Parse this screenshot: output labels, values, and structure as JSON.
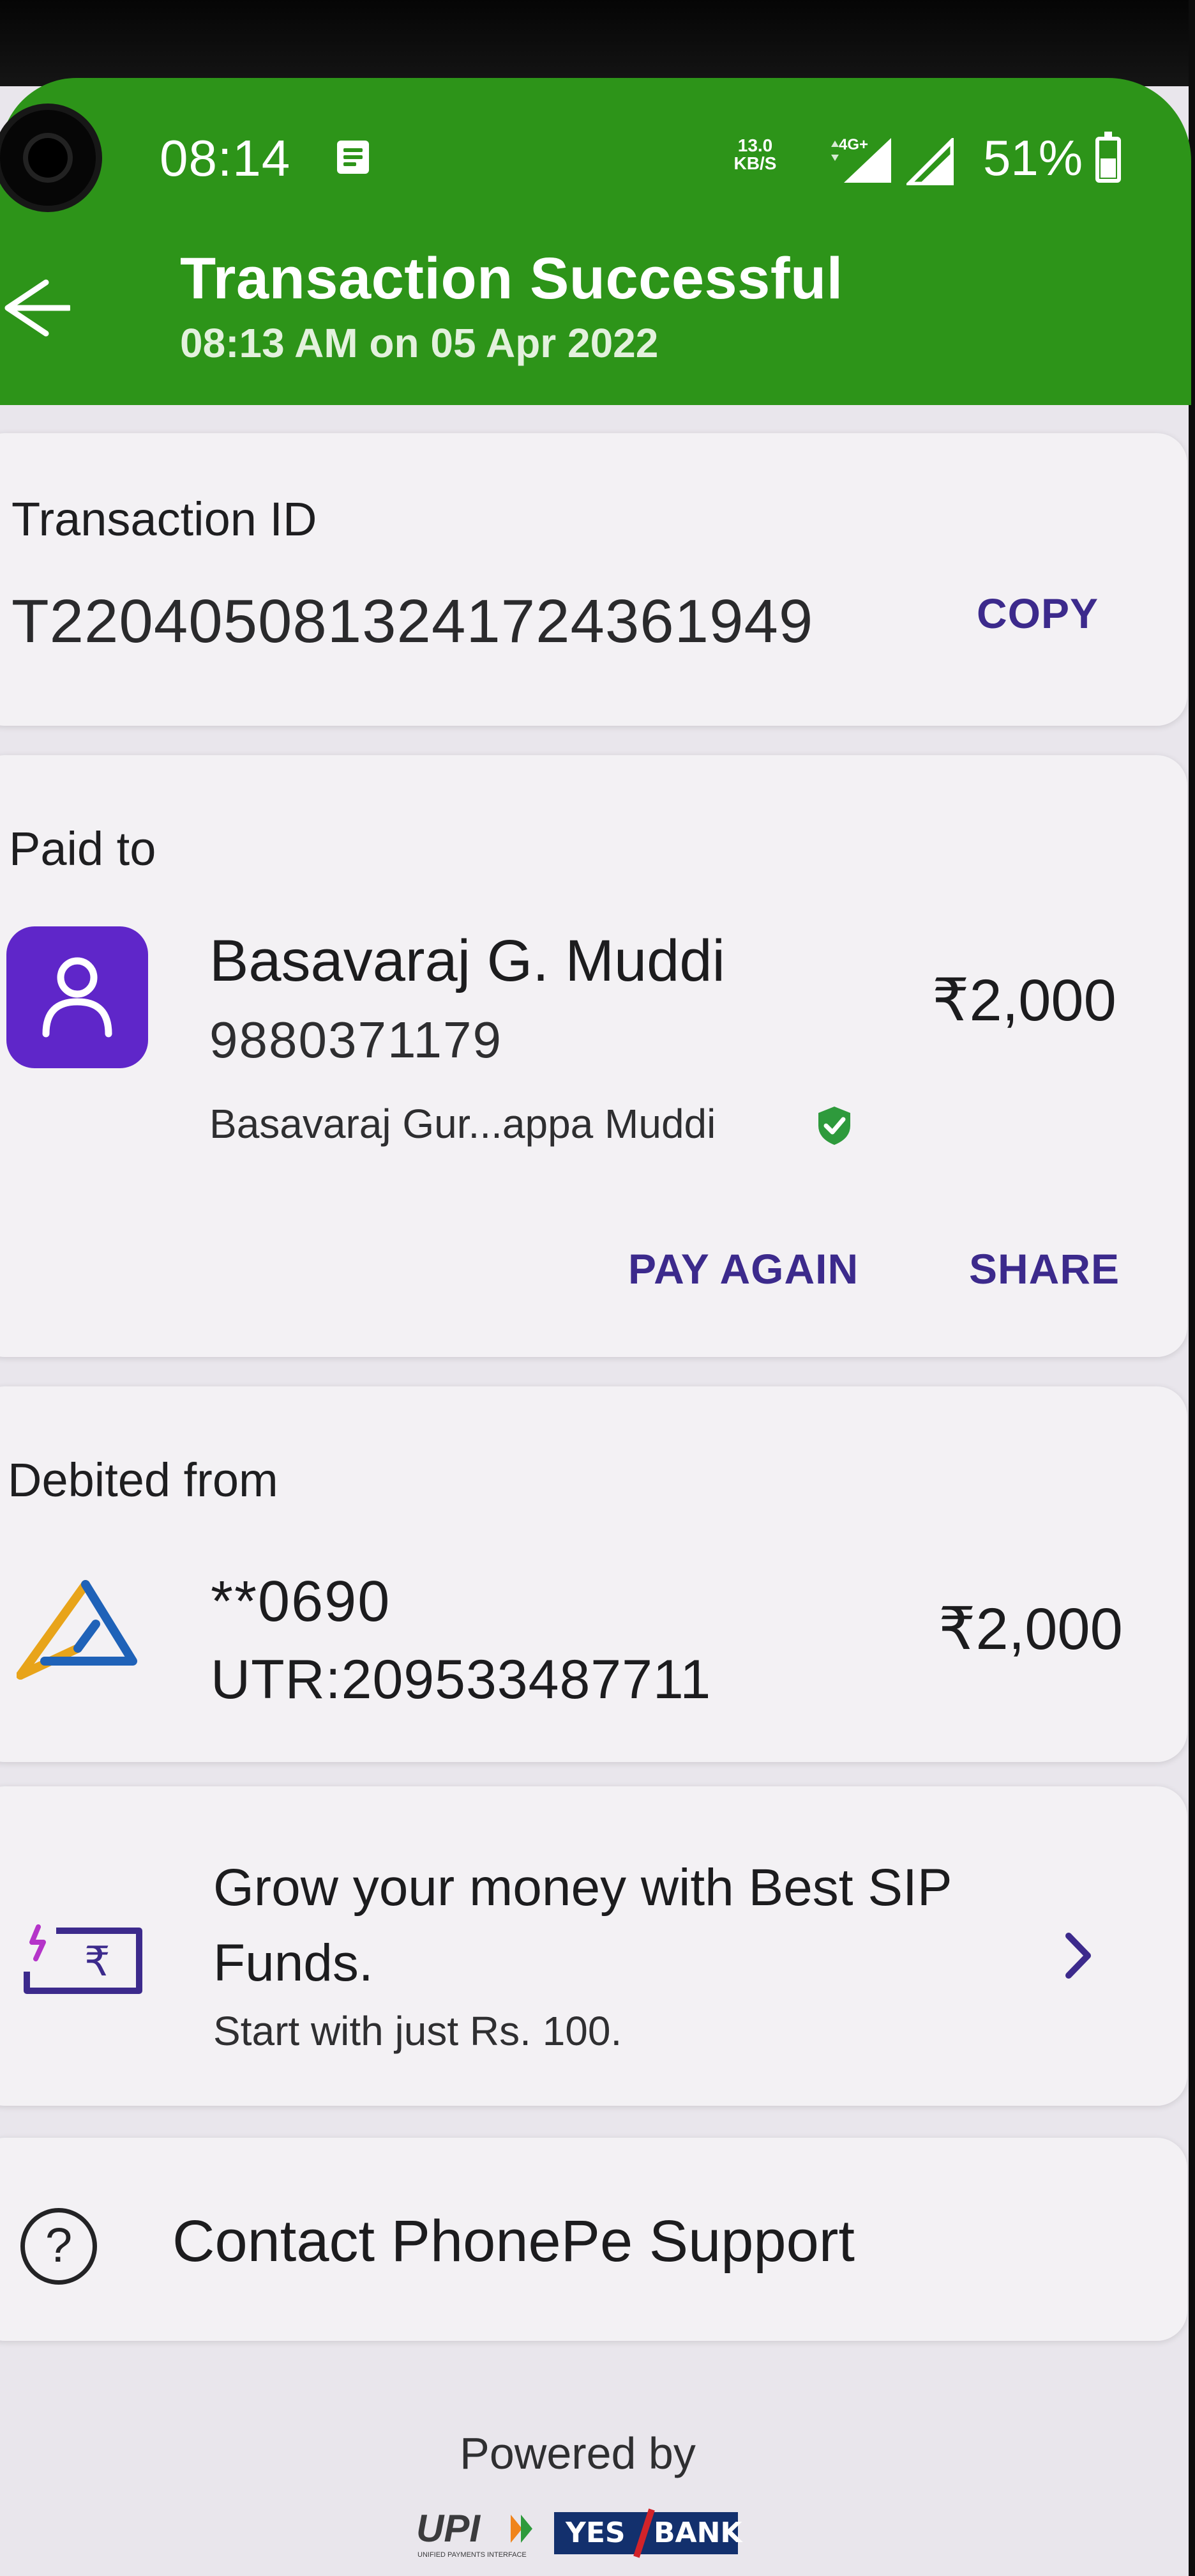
{
  "status_bar": {
    "time": "08:14",
    "net_speed_value": "13.0",
    "net_speed_unit": "KB/S",
    "network_type": "4G+",
    "battery": "51%"
  },
  "header": {
    "title": "Transaction Successful",
    "subtitle": "08:13 AM on 05 Apr 2022",
    "background_color": "#2d9419"
  },
  "transaction": {
    "label": "Transaction ID",
    "id": "T2204050813241724361949",
    "copy_label": "COPY"
  },
  "paid_to": {
    "label": "Paid to",
    "name": "Basavaraj G. Muddi",
    "phone": "9880371179",
    "full_name": "Basavaraj Gur...appa Muddi",
    "amount": "₹2,000",
    "pay_again_label": "PAY AGAIN",
    "share_label": "SHARE"
  },
  "debited_from": {
    "label": "Debited from",
    "account": "**0690",
    "utr": "UTR:209533487711",
    "amount": "₹2,000"
  },
  "promo": {
    "title": "Grow your money with Best SIP Funds.",
    "subtitle": "Start with just Rs. 100.",
    "icon": "rupee-card-icon"
  },
  "support": {
    "label": "Contact PhonePe Support",
    "icon": "help-circle-icon"
  },
  "footer": {
    "powered_by": "Powered by",
    "upi_text": "UPI",
    "upi_tagline": "UNIFIED PAYMENTS INTERFACE",
    "bank_word1": "YES",
    "bank_word2": "BANK"
  },
  "colors": {
    "accent_purple": "#3c2a8c",
    "avatar_purple": "#5f26c9",
    "success_green": "#2d9419"
  }
}
